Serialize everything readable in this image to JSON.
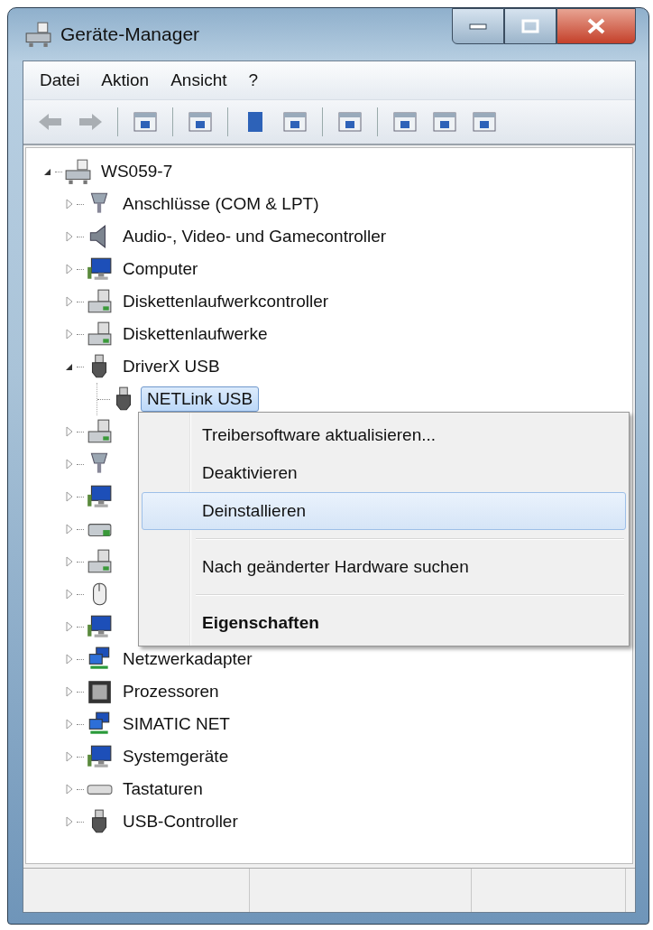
{
  "window": {
    "title": "Geräte-Manager"
  },
  "menu_bar": [
    {
      "label": "Datei"
    },
    {
      "label": "Aktion"
    },
    {
      "label": "Ansicht"
    },
    {
      "label": "?"
    }
  ],
  "toolbar": [
    {
      "kind": "button",
      "disabled": true
    },
    {
      "kind": "button",
      "disabled": true
    },
    {
      "kind": "separator"
    },
    {
      "kind": "button",
      "disabled": false
    },
    {
      "kind": "separator"
    },
    {
      "kind": "button",
      "disabled": false
    },
    {
      "kind": "separator"
    },
    {
      "kind": "button",
      "disabled": false
    },
    {
      "kind": "button",
      "disabled": false
    },
    {
      "kind": "separator"
    },
    {
      "kind": "button",
      "disabled": false
    },
    {
      "kind": "separator"
    },
    {
      "kind": "button",
      "disabled": false
    },
    {
      "kind": "button",
      "disabled": false
    },
    {
      "kind": "button",
      "disabled": false
    }
  ],
  "tree": {
    "label": "WS059-7",
    "expanded": true,
    "selected": false,
    "children": [
      {
        "label": "Anschlüsse (COM & LPT)",
        "expanded": false,
        "selected": false
      },
      {
        "label": "Audio-, Video- und Gamecontroller",
        "expanded": false,
        "selected": false
      },
      {
        "label": "Computer",
        "expanded": false,
        "selected": false
      },
      {
        "label": "Diskettenlaufwerkcontroller",
        "expanded": false,
        "selected": false
      },
      {
        "label": "Diskettenlaufwerke",
        "expanded": false,
        "selected": false
      },
      {
        "label": "DriverX USB",
        "expanded": true,
        "selected": false,
        "children": [
          {
            "label": "NETLink USB",
            "selected": true
          }
        ]
      },
      {
        "expanded": false
      },
      {
        "expanded": false
      },
      {
        "expanded": false
      },
      {
        "expanded": false
      },
      {
        "expanded": false
      },
      {
        "expanded": false
      },
      {
        "expanded": false
      },
      {
        "label": "Netzwerkadapter",
        "expanded": false,
        "selected": false
      },
      {
        "label": "Prozessoren",
        "expanded": false,
        "selected": false
      },
      {
        "label": "SIMATIC NET",
        "expanded": false,
        "selected": false
      },
      {
        "label": "Systemgeräte",
        "expanded": false,
        "selected": false
      },
      {
        "label": "Tastaturen",
        "expanded": false,
        "selected": false
      },
      {
        "label": "USB-Controller",
        "expanded": false,
        "selected": false
      }
    ]
  },
  "context_menu": [
    {
      "kind": "item",
      "label": "Treibersoftware aktualisieren...",
      "selected": false,
      "default": false
    },
    {
      "kind": "item",
      "label": "Deaktivieren",
      "selected": false,
      "default": false
    },
    {
      "kind": "item",
      "label": "Deinstallieren",
      "selected": true,
      "default": false
    },
    {
      "kind": "separator"
    },
    {
      "kind": "item",
      "label": "Nach geänderter Hardware suchen",
      "selected": false,
      "default": false
    },
    {
      "kind": "separator"
    },
    {
      "kind": "item",
      "label": "Eigenschaften",
      "selected": false,
      "default": true
    }
  ]
}
